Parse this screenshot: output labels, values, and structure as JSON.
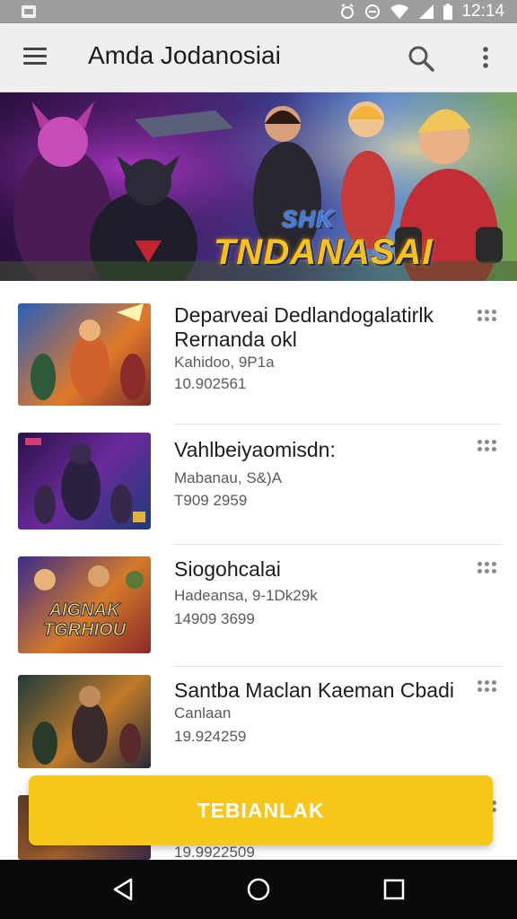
{
  "status_bar": {
    "time": "12:14",
    "icons": [
      "notification-icon",
      "alarm-icon",
      "do-not-disturb-icon",
      "wifi-icon",
      "signal-icon",
      "battery-icon"
    ]
  },
  "app_bar": {
    "title": "Amda Jodanosiai",
    "icons": [
      "menu-icon",
      "search-icon",
      "more-vert-icon"
    ]
  },
  "hero": {
    "logo_top": "SHK",
    "logo_main": "TNDANASAI"
  },
  "list": {
    "items": [
      {
        "title_line1": "Deparveai Dedlandogalatirlk",
        "title_line2": "Rernanda okl",
        "subtitle": "Kahidoo, 9P1a",
        "number": "10.902561"
      },
      {
        "title_line1": "Vahlbeiyaomisdn:",
        "title_line2": "",
        "subtitle": "Mabanau, S&)A",
        "number": "T909 2959"
      },
      {
        "title_line1": "Siogohcalai",
        "title_line2": "",
        "subtitle": "Hadeansa, 9-1Dk29k",
        "number": "14909 3699"
      },
      {
        "title_line1": "Santba Maclan Kaeman Cbadi",
        "title_line2": "",
        "subtitle": "Canlaan",
        "number": "19.924259"
      },
      {
        "title_line1": "",
        "title_line2": "",
        "subtitle": "",
        "number": "19.9922509"
      }
    ]
  },
  "thumb_overlay": {
    "item3_line1": "AIGNAK",
    "item3_line2": "TGRHIOU"
  },
  "cta": {
    "label": "TEBIANLAK"
  },
  "nav_bar": {
    "icons": [
      "back-icon",
      "home-icon",
      "recents-icon"
    ]
  },
  "colors": {
    "status_bar": "#9e9e9e",
    "app_bar": "#efefef",
    "accent": "#f8c61a",
    "nav_bar": "#0a0a0a"
  }
}
